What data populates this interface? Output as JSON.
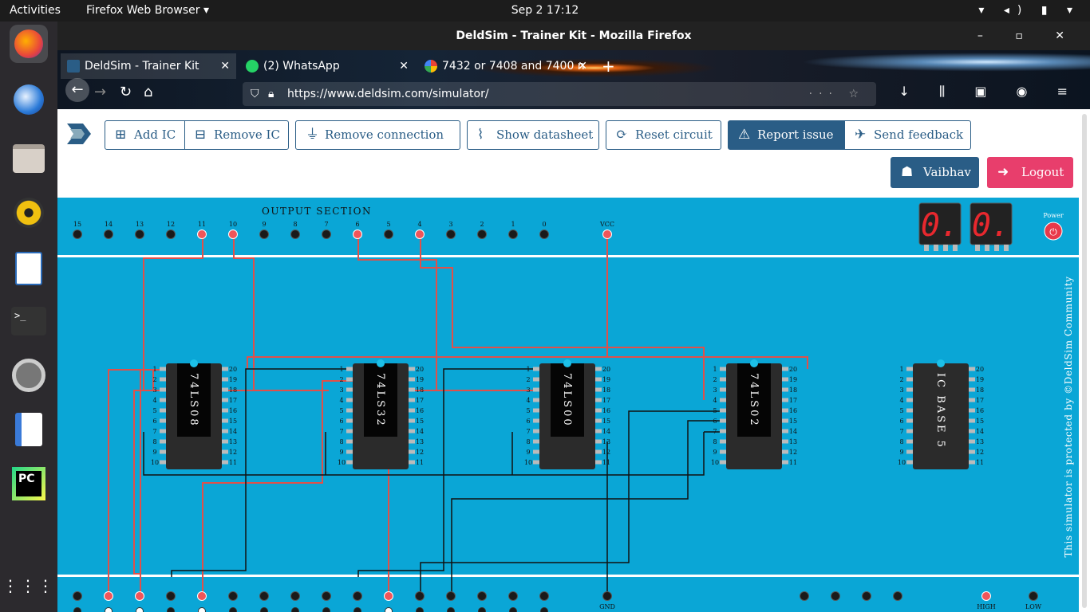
{
  "topbar": {
    "activities": "Activities",
    "app": "Firefox Web Browser ▾",
    "clock": "Sep 2  17:12",
    "tray": "▾ ◂) ▮ ▾"
  },
  "window": {
    "title": "DeldSim - Trainer Kit - Mozilla Firefox",
    "controls": "– ▫ ✕"
  },
  "tabs": [
    {
      "label": "DeldSim - Trainer Kit",
      "close": "✕"
    },
    {
      "label": "(2) WhatsApp",
      "close": "✕"
    },
    {
      "label": "7432 or 7408 and 7400 n",
      "close": "✕"
    }
  ],
  "new_tab": "+",
  "url": "https://www.deldsim.com/simulator/",
  "nav": {
    "back": "←",
    "forward": "→",
    "reload": "↻",
    "home": "⌂"
  },
  "toolbar_buttons": {
    "add_ic": "Add IC",
    "remove_ic": "Remove IC",
    "remove_connection": "Remove connection",
    "show_datasheet": "Show datasheet",
    "reset_circuit": "Reset circuit",
    "report_issue": "Report issue",
    "send_feedback": "Send feedback",
    "user": "Vaibhav",
    "logout": "Logout"
  },
  "board": {
    "output_section": "OUTPUT SECTION",
    "output_pins": [
      "15",
      "14",
      "13",
      "12",
      "11",
      "10",
      "9",
      "8",
      "7",
      "6",
      "5",
      "4",
      "3",
      "2",
      "1",
      "0"
    ],
    "output_active": [
      "11",
      "10",
      "6",
      "4"
    ],
    "vcc": "VCC",
    "power": "Power",
    "gnd": "GND",
    "high": "HIGH",
    "low": "LOW",
    "seven_segment": [
      "0.",
      "0."
    ],
    "copyright": "This simulator is protected by ©DeldSim Community",
    "ics": [
      {
        "label": "74LS08"
      },
      {
        "label": "74LS32"
      },
      {
        "label": "74LS00"
      },
      {
        "label": "74LS02"
      },
      {
        "label": "IC BASE 5"
      }
    ],
    "left_pins": [
      "1",
      "2",
      "3",
      "4",
      "5",
      "6",
      "7",
      "8",
      "9",
      "10"
    ],
    "right_pins": [
      "20",
      "19",
      "18",
      "17",
      "16",
      "15",
      "14",
      "13",
      "12",
      "11"
    ],
    "input_active": [
      1,
      2,
      4,
      10
    ]
  },
  "colors": {
    "board": "#0aa6d6",
    "wire_red": "#e0504a",
    "wire_black": "#111111",
    "led_on": "#f0555a",
    "accent": "#2a5d86"
  }
}
